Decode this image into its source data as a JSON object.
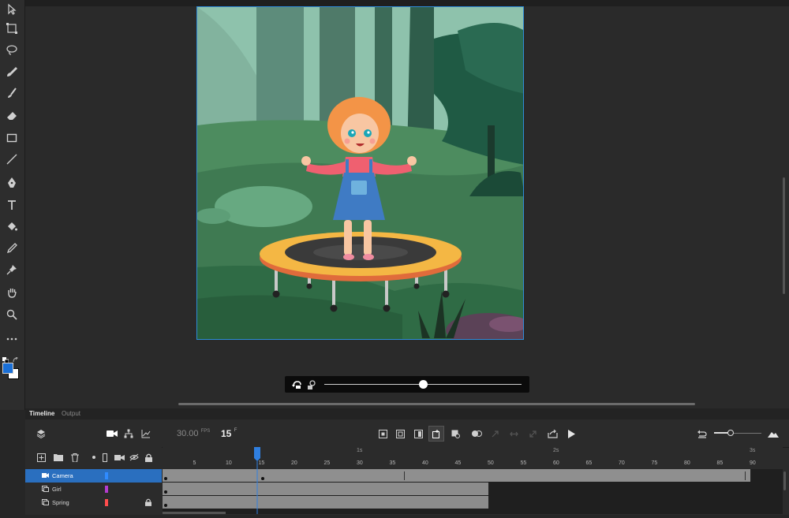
{
  "tools": [
    {
      "name": "selection-tool-icon"
    },
    {
      "name": "free-transform-tool-icon"
    },
    {
      "name": "lasso-tool-icon"
    },
    {
      "name": "paint-brush-tool-icon"
    },
    {
      "name": "brush-tool-icon"
    },
    {
      "name": "eraser-tool-icon"
    },
    {
      "name": "rectangle-tool-icon"
    },
    {
      "name": "line-tool-icon"
    },
    {
      "name": "pen-tool-icon"
    },
    {
      "name": "text-tool-icon"
    },
    {
      "name": "paint-bucket-tool-icon"
    },
    {
      "name": "eyedropper-tool-icon"
    },
    {
      "name": "pin-tool-icon"
    },
    {
      "name": "hand-tool-icon"
    },
    {
      "name": "zoom-tool-icon"
    },
    {
      "name": "more-tools-icon"
    }
  ],
  "colors": {
    "accent": "#2f8bd8",
    "fill_swatch": "#1a6fd6",
    "stroke_swatch": "#ffffff",
    "layer_camera": "#2f8bff",
    "layer_girl": "#b33ccf",
    "layer_spring": "#ff4d4d"
  },
  "tabs": {
    "timeline": "Timeline",
    "output": "Output"
  },
  "timeline": {
    "fps_value": "30.00",
    "fps_unit": "FPS",
    "frame_value": "15",
    "frame_unit": "F",
    "ruler_frames": [
      "5",
      "10",
      "15",
      "20",
      "25",
      "30",
      "35",
      "40",
      "45",
      "50",
      "55",
      "60",
      "65",
      "70",
      "75",
      "80",
      "85",
      "90"
    ],
    "ruler_seconds": [
      "1s",
      "2s",
      "3s"
    ],
    "layers": [
      {
        "name": "Camera",
        "selected": true
      },
      {
        "name": "Girl",
        "selected": false
      },
      {
        "name": "Spring",
        "selected": false,
        "locked": true
      }
    ]
  }
}
